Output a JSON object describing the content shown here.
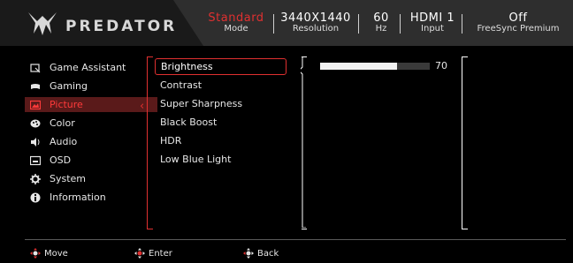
{
  "brand": {
    "name": "PREDATOR",
    "logo_icon": "predator-claw-icon"
  },
  "header": {
    "mode": {
      "value": "Standard",
      "label": "Mode"
    },
    "resolution": {
      "value": "3440X1440",
      "label": "Resolution"
    },
    "refresh": {
      "value": "60",
      "label": "Hz"
    },
    "input": {
      "value": "HDMI 1",
      "label": "Input"
    },
    "freesync": {
      "value": "Off",
      "label": "FreeSync Premium"
    }
  },
  "menu": {
    "items": [
      {
        "label": "Game Assistant",
        "icon": "game-assistant-icon"
      },
      {
        "label": "Gaming",
        "icon": "gamepad-icon"
      },
      {
        "label": "Picture",
        "icon": "picture-icon",
        "selected": true
      },
      {
        "label": "Color",
        "icon": "palette-icon"
      },
      {
        "label": "Audio",
        "icon": "speaker-icon"
      },
      {
        "label": "OSD",
        "icon": "osd-icon"
      },
      {
        "label": "System",
        "icon": "gear-icon"
      },
      {
        "label": "Information",
        "icon": "info-icon"
      }
    ]
  },
  "submenu": {
    "items": [
      {
        "label": "Brightness",
        "selected": true
      },
      {
        "label": "Contrast"
      },
      {
        "label": "Super Sharpness"
      },
      {
        "label": "Black Boost"
      },
      {
        "label": "HDR"
      },
      {
        "label": "Low Blue Light"
      }
    ]
  },
  "value": {
    "number": "70",
    "fraction": 0.7
  },
  "footer": {
    "move": "Move",
    "enter": "Enter",
    "back": "Back"
  },
  "colors": {
    "accent": "#e03030",
    "header_bg": "#2a2a2a",
    "background": "#000000"
  }
}
